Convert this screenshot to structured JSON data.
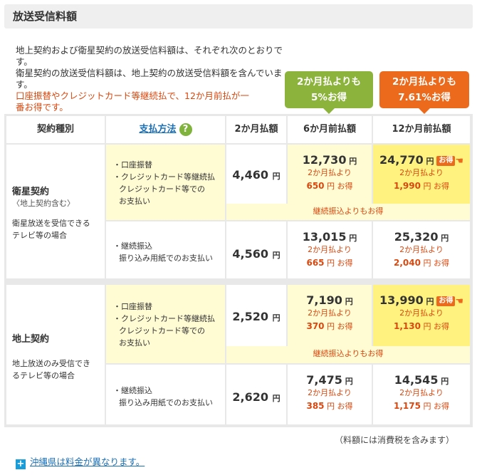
{
  "title": "放送受信料額",
  "intro": {
    "line1": "地上契約および衛星契約の放送受信料額は、それぞれ次のとおりです。",
    "line2": "衛星契約の放送受信料額は、地上契約の放送受信料額を含んでいます。",
    "red_line1": "口座振替やクレジットカード等継続払で、12か月前払が一",
    "red_line2": "番お得です。"
  },
  "bubbles": {
    "green_line1": "2か月払よりも",
    "green_line2": "5%お得",
    "orange_line1": "2か月払よりも",
    "orange_line2": "7.61%お得"
  },
  "table": {
    "headers": {
      "type": "契約種別",
      "method": "支払方法",
      "method_icon": "?",
      "two_month": "2か月払額",
      "six_month": "6か月前払額",
      "twelve_month": "12か月前払額"
    },
    "satellite": {
      "name": "衛星契約",
      "sub": "〈地上契約含む〉",
      "desc_line1": "衛星放送を受信できる",
      "desc_line2": "テレビ等の場合",
      "row1": {
        "method_line1": "・口座振替",
        "method_line2": "・クレジットカード等継続払",
        "method_line3": "クレジットカード等での",
        "method_line4": "お支払い",
        "two_month": "4,460",
        "six_month": "12,730",
        "six_saving": "650",
        "twelve_month": "24,770",
        "twelve_saving": "1,990"
      },
      "note": "継続振込よりもお得",
      "row2": {
        "method_line1": "・継続振込",
        "method_line2": "振り込み用紙でのお支払い",
        "two_month": "4,560",
        "six_month": "13,015",
        "six_saving": "665",
        "twelve_month": "25,320",
        "twelve_saving": "2,040"
      }
    },
    "terrestrial": {
      "name": "地上契約",
      "desc_line1": "地上放送のみ受信でき",
      "desc_line2": "るテレビ等の場合",
      "row1": {
        "method_line1": "・口座振替",
        "method_line2": "・クレジットカード等継続払",
        "method_line3": "クレジットカード等での",
        "method_line4": "お支払い",
        "two_month": "2,520",
        "six_month": "7,190",
        "six_saving": "370",
        "twelve_month": "13,990",
        "twelve_saving": "1,130"
      },
      "note": "継続振込よりもお得",
      "row2": {
        "method_line1": "・継続振込",
        "method_line2": "振り込み用紙でのお支払い",
        "two_month": "2,620",
        "six_month": "7,475",
        "six_saving": "385",
        "twelve_month": "14,545",
        "twelve_saving": "1,175"
      }
    },
    "yen": "円",
    "compare_label": "2か月払より",
    "otoku_suffix": "円 お得",
    "badge": "お得"
  },
  "tax_note": "（料額には消費税を含みます）",
  "okinawa_link": "沖縄県は料金が異なります。",
  "colors": {
    "accent_orange": "#ec6a1c",
    "accent_green": "#8cb33c",
    "highlight_yellow": "#fff27f",
    "light_yellow": "#fffbd3",
    "link_blue": "#1a6fb5"
  }
}
